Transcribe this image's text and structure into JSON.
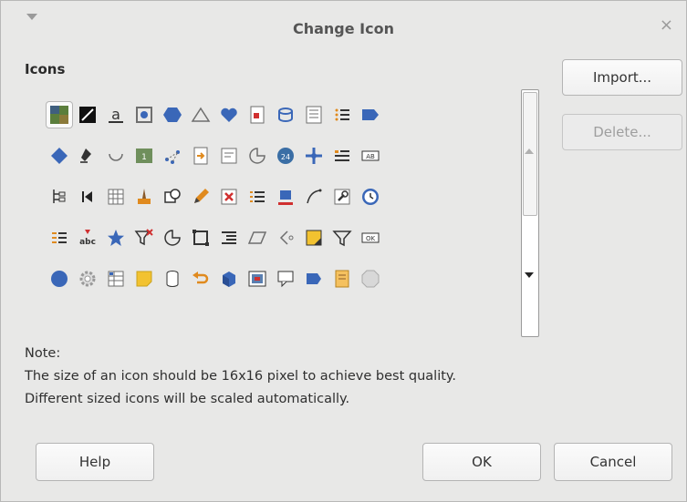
{
  "window": {
    "title": "Change Icon",
    "close_glyph": "×",
    "menu_icon": "triangle-down-icon"
  },
  "icons_section": {
    "label": "Icons"
  },
  "icon_rows": [
    [
      "photo",
      "black-white-square",
      "image-anchor",
      "image-frame",
      "hexagon",
      "triangle-outline",
      "heart",
      "form-document",
      "db-refresh",
      "column-list",
      "bullet-list",
      "pentagon-arrow"
    ],
    [
      "diamond",
      "stamp",
      "smile-arc",
      "image-map",
      "shape-points",
      "insert-file",
      "text-box",
      "pie-outline",
      "calendar-24",
      "move-cross",
      "text-list",
      "text-field"
    ],
    [
      "tree-view",
      "skip-first",
      "table-grid",
      "paint-brush",
      "shapes-3d",
      "pencil",
      "delete-box",
      "numbered-list",
      "underline-box",
      "curve",
      "wrench",
      "clock"
    ],
    [
      "numbered-list-2",
      "spell-check",
      "star",
      "filter-delete",
      "circle-arc",
      "polygon-select",
      "indent-list",
      "parallelogram",
      "chevron-back",
      "folded-corner",
      "funnel",
      "ok-button"
    ],
    [
      "circle-blue",
      "gear",
      "data-table",
      "sticky-note",
      "cylinder",
      "undo-arrow",
      "cube",
      "image-window",
      "callout",
      "flowchart-box",
      "document-orange",
      "octagon"
    ]
  ],
  "selected_icon": "photo",
  "buttons": {
    "import": "Import...",
    "delete": "Delete...",
    "help": "Help",
    "ok": "OK",
    "cancel": "Cancel"
  },
  "note": {
    "heading": "Note:",
    "line1": "The size of an icon should be 16x16 pixel to achieve best quality.",
    "line2": "Different sized icons will be scaled automatically."
  },
  "colors": {
    "accent_blue": "#3a67b8",
    "background": "#e8e8e7"
  }
}
